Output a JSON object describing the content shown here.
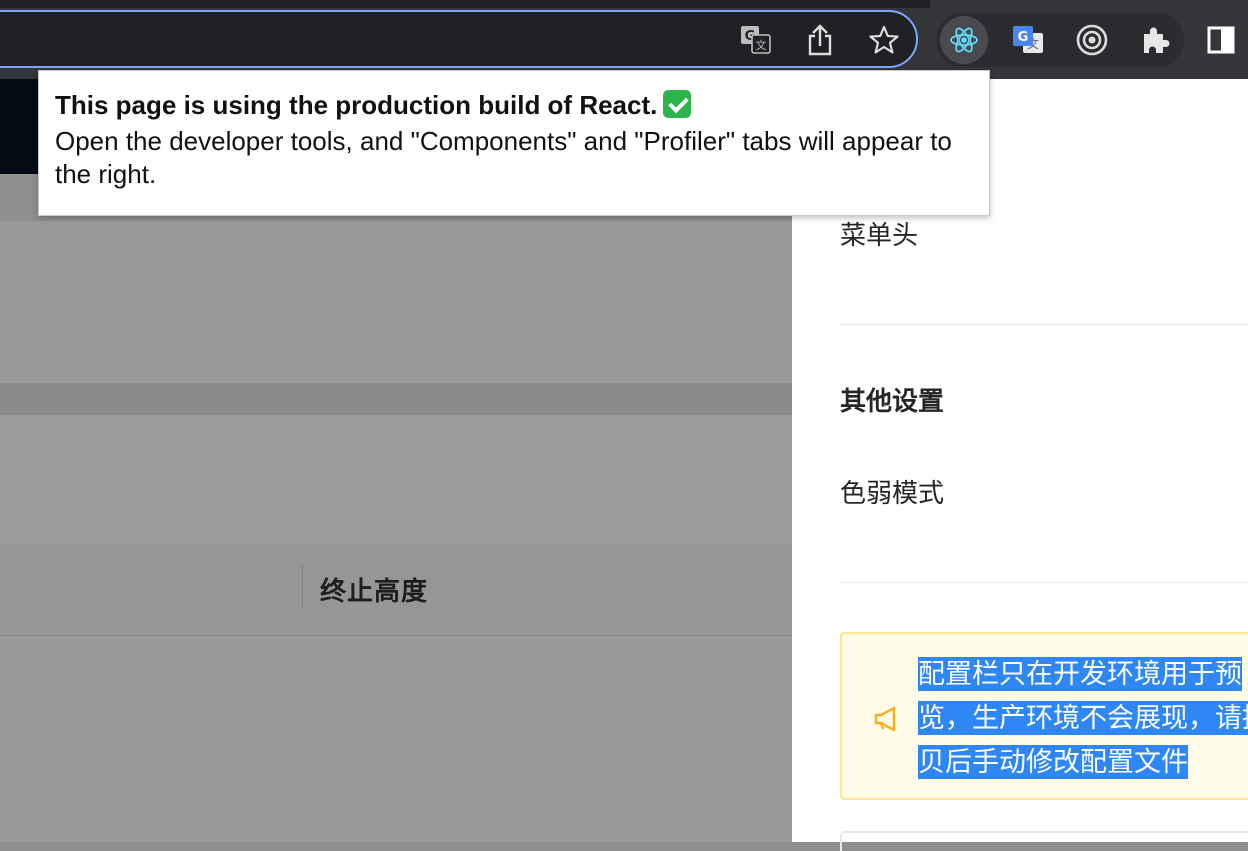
{
  "toolbar": {
    "icons": [
      "translate-icon",
      "share-icon",
      "bookmark-star-icon"
    ],
    "extensions": [
      "react-devtools-icon",
      "google-translate-icon",
      "record-target-icon",
      "extensions-puzzle-icon"
    ],
    "side_panel_icon": "side-panel-icon",
    "accent_color": "#7aa7ff"
  },
  "page": {
    "table_column_header": "终止高度"
  },
  "drawer": {
    "menu_header_label": "菜单头",
    "other_settings_title": "其他设置",
    "weak_color_mode_label": "色弱模式",
    "alert": {
      "icon": "notification-icon",
      "text": "配置栏只在开发环境用于预览，生产环境不会展现，请拷贝后手动修改配置文件"
    }
  },
  "popup": {
    "title": "This page is using the production build of React.",
    "body": "Open the developer tools, and \"Components\" and \"Profiler\" tabs will appear to the right.",
    "check_icon": "check-mark-icon",
    "check_color": "#2db44a"
  }
}
